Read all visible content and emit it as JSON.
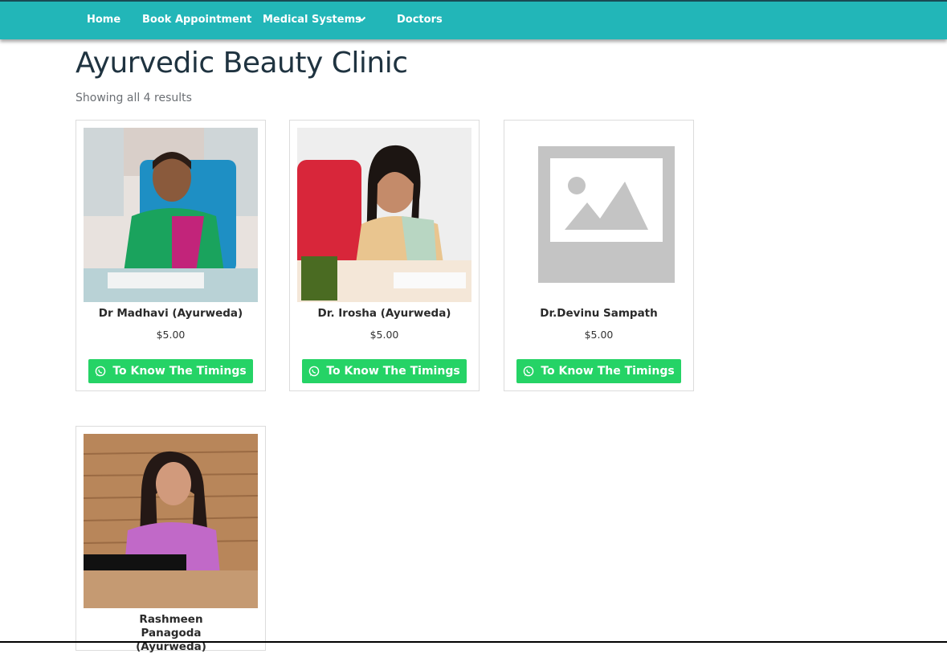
{
  "nav": {
    "items": [
      {
        "label": "Home"
      },
      {
        "label": "Book Appointment"
      },
      {
        "label": "Medical Systems"
      },
      {
        "label": "Doctors"
      }
    ]
  },
  "page": {
    "title": "Ayurvedic Beauty Clinic",
    "result_count": "Showing all 4 results"
  },
  "products": [
    {
      "name": "Dr Madhavi (Ayurweda)",
      "price": "$5.00",
      "button_label": "To Know The Timings",
      "image": "doctor-photo"
    },
    {
      "name": "Dr. Irosha (Ayurweda)",
      "price": "$5.00",
      "button_label": "To Know The Timings",
      "image": "doctor-photo"
    },
    {
      "name": "Dr.Devinu Sampath",
      "price": "$5.00",
      "button_label": "To Know The Timings",
      "image": "placeholder-image"
    },
    {
      "name": "Rashmeen Panagoda (Ayurweda)",
      "price": "",
      "button_label": "",
      "image": "doctor-photo"
    }
  ],
  "colors": {
    "navbar": "#22b6b8",
    "button": "#25d366",
    "title": "#1f3340"
  },
  "icons": {
    "dropdown": "chevron-down-icon",
    "button": "whatsapp-icon"
  }
}
